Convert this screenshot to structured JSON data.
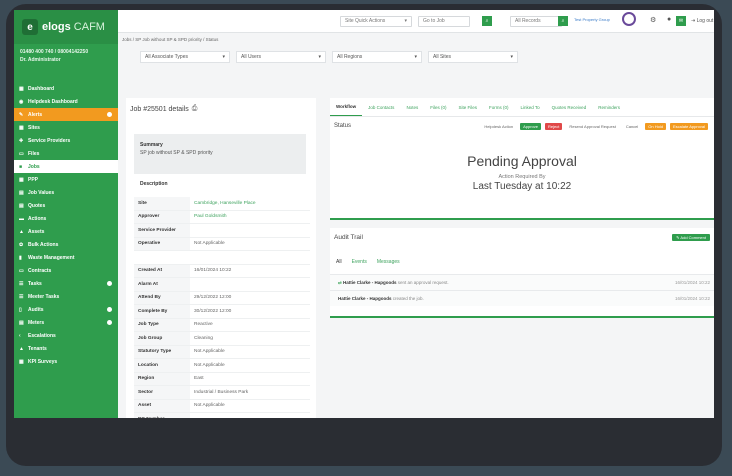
{
  "brand": {
    "name_main": "elogs",
    "name_suffix": "CAFM"
  },
  "contact": {
    "line1": "01480 400 740 / 08004142250",
    "line2": "Dr. Administrator"
  },
  "sidebar": {
    "items": [
      {
        "label": "Dashboard",
        "state": "normal"
      },
      {
        "label": "Helpdesk Dashboard",
        "state": "normal"
      },
      {
        "label": "Alerts",
        "state": "alert",
        "dot": true
      },
      {
        "label": "Sites",
        "state": "normal"
      },
      {
        "label": "Service Providers",
        "state": "normal"
      },
      {
        "label": "Files",
        "state": "normal"
      },
      {
        "label": "Jobs",
        "state": "active"
      },
      {
        "label": "PPP",
        "state": "normal"
      },
      {
        "label": "Job Values",
        "state": "normal"
      },
      {
        "label": "Quotes",
        "state": "normal"
      },
      {
        "label": "Actions",
        "state": "normal"
      },
      {
        "label": "Assets",
        "state": "normal"
      },
      {
        "label": "Bulk Actions",
        "state": "normal"
      },
      {
        "label": "Waste Management",
        "state": "normal"
      },
      {
        "label": "Contracts",
        "state": "normal"
      },
      {
        "label": "Tasks",
        "state": "normal",
        "dot": true
      },
      {
        "label": "Meeter Tasks",
        "state": "normal"
      },
      {
        "label": "Audits",
        "state": "normal",
        "dot": true
      },
      {
        "label": "Meters",
        "state": "normal",
        "dot": true
      },
      {
        "label": "Escalations",
        "state": "normal"
      },
      {
        "label": "Tenants",
        "state": "normal"
      },
      {
        "label": "KPI Surveys",
        "state": "normal"
      }
    ]
  },
  "topbar": {
    "quick_actions": "Site Quick Actions",
    "goto_job": "Go to Job",
    "search_label": "All Records",
    "brand_text": "Test Property Group",
    "logout": "Log out"
  },
  "breadcrumb": "Jobs / SP Job without SP & SPD priority / Status",
  "filters": [
    {
      "label": "All Associate Types"
    },
    {
      "label": "All Users"
    },
    {
      "label": "All Regions"
    },
    {
      "label": "All Sites"
    }
  ],
  "job": {
    "title": "Job #25501 details",
    "summary_label": "Summary",
    "summary_text": "SP job without SP & SPD priority",
    "description_label": "Description",
    "fields": [
      {
        "k": "Site",
        "v": "Cambridge, Hanseville Place",
        "link": true
      },
      {
        "k": "Approver",
        "v": "Paul Goldsmith",
        "link": true
      },
      {
        "k": "Service Provider",
        "v": ""
      },
      {
        "k": "Operative",
        "v": "Not Applicable"
      },
      {
        "k": "",
        "v": "",
        "gap": true
      },
      {
        "k": "Created At",
        "v": "16/01/2024 10:22"
      },
      {
        "k": "Alarm At",
        "v": ""
      },
      {
        "k": "Attend By",
        "v": "29/12/2022 12:00"
      },
      {
        "k": "Complete By",
        "v": "30/12/2022 12:00"
      },
      {
        "k": "Job Type",
        "v": "Reactive"
      },
      {
        "k": "Job Group",
        "v": "Cleaning"
      },
      {
        "k": "Statutory Type",
        "v": "Not Applicable"
      },
      {
        "k": "Location",
        "v": "Not Applicable"
      },
      {
        "k": "Region",
        "v": "East"
      },
      {
        "k": "Sector",
        "v": "Industrial / Business Park"
      },
      {
        "k": "Asset",
        "v": "Not Applicable"
      },
      {
        "k": "PO Number",
        "v": ""
      }
    ]
  },
  "workflow": {
    "tabs": [
      "Workflow",
      "Job Contacts",
      "Notes",
      "Files (0)",
      "Site Files",
      "Forms (0)",
      "Linked To",
      "Quotes Received",
      "Reminders"
    ],
    "status_label": "Status",
    "chain": [
      {
        "label": "Helpdesk Action",
        "bg": "",
        "color": "#666"
      },
      {
        "label": "Approve",
        "bg": "#2f9d4d",
        "color": "#fff"
      },
      {
        "label": "Reject",
        "bg": "#e04848",
        "color": "#fff"
      },
      {
        "label": "Resend Approval Request",
        "bg": "",
        "color": "#666"
      },
      {
        "label": "Cancel",
        "bg": "",
        "color": "#666"
      },
      {
        "label": "On Hold",
        "bg": "#f29a1f",
        "color": "#fff"
      },
      {
        "label": "Escalate Approval",
        "bg": "#f29a1f",
        "color": "#fff"
      }
    ],
    "pending_title": "Pending Approval",
    "action_required": "Action Required By",
    "when": "Last Tuesday at 10:22"
  },
  "audit": {
    "title": "Audit Trail",
    "add_label": "Add Comment",
    "tabs": [
      "All",
      "Events",
      "Messages"
    ],
    "rows": [
      {
        "who": "Hattie Clarke - Hapgoods",
        "text": " sent an approval request.",
        "ts": "16/01/2024 10:22"
      },
      {
        "who": "Hattie Clarke - Hapgoods",
        "text": " created the job.",
        "ts": "16/01/2024 10:22"
      }
    ]
  },
  "colors": {
    "brand": "#2f9d4d",
    "alert": "#f29a1f",
    "danger": "#e04848"
  }
}
